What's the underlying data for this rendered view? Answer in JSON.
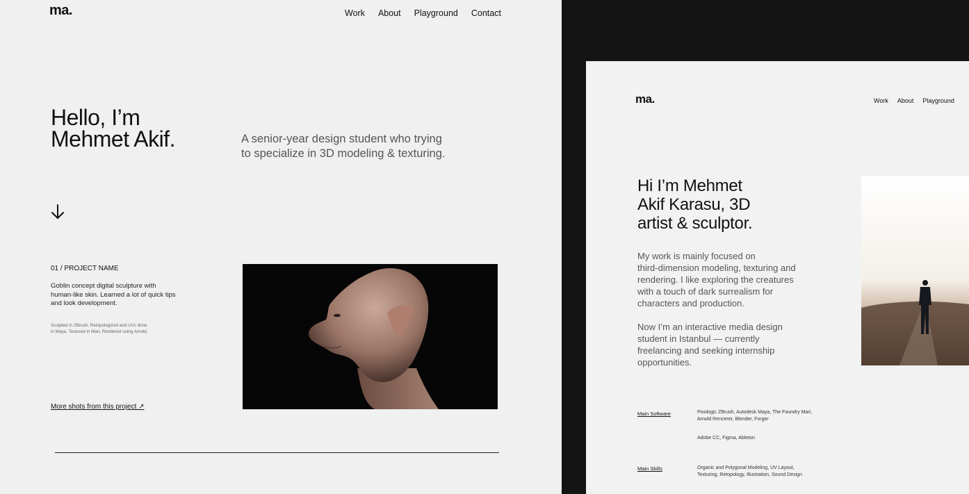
{
  "left": {
    "logo": "ma.",
    "nav": [
      "Work",
      "About",
      "Playground",
      "Contact"
    ],
    "hero": [
      "Hello, I’m",
      "Mehmet Akif."
    ],
    "tagline": [
      "A senior-year design student who trying",
      "to specialize in 3D modeling & texturing."
    ],
    "project": {
      "title": "01 / PROJECT NAME",
      "description": [
        "Goblin concept digital sculpture with",
        "human-like skin. Learned a lot of quick tips",
        "and look development."
      ],
      "note": [
        "Sculpted in ZBrush, Retopologized and UVs done",
        "in Maya, Textured in Mari, Rendered using Arnold."
      ],
      "link": "More shots from this project ↗"
    }
  },
  "right": {
    "logo": "ma.",
    "nav": [
      "Work",
      "About",
      "Playground"
    ],
    "hero": [
      "Hi I’m Mehmet",
      "Akif Karasu, 3D",
      "artist & sculptor."
    ],
    "para1": [
      "My work is mainly focused on",
      "third-dimension modeling, texturing and",
      "rendering. I like exploring the creatures",
      "with a touch of dark surrealism for",
      "characters and production."
    ],
    "para2": [
      "Now I’m an interactive media design",
      "student in Istanbul — currently",
      "freelancing and seeking internship",
      "opportunities."
    ],
    "software_label": "Main Software",
    "software": [
      "Pixologic ZBrush, Autodesk Maya, The Foundry Mari,",
      "Arnold Rencerer, Blender, Forger"
    ],
    "software_extra": "Adobe CC, Figma, Ableton",
    "skills_label": "Main Skills",
    "skills": [
      "Organic and Polygonal Modeling, UV Layout,",
      "Texturing, Retopology, Illustration, Sound Design"
    ]
  },
  "colors": {
    "page_bg": "#f0f0f0",
    "dark_bg": "#141414",
    "text": "#111111",
    "muted": "#555555"
  },
  "icons": [
    "arrow-down-icon",
    "external-link-icon"
  ]
}
